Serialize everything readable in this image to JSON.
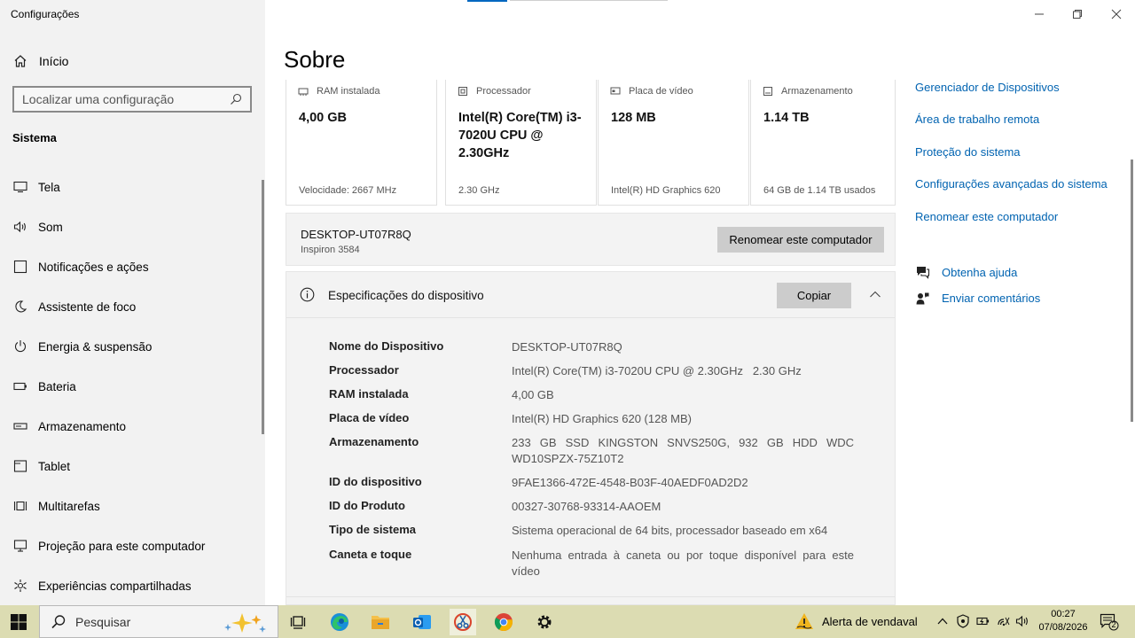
{
  "window": {
    "title": "Configurações"
  },
  "sidebar": {
    "home_label": "Início",
    "search_placeholder": "Localizar uma configuração",
    "section_title": "Sistema",
    "items": [
      {
        "label": "Tela",
        "icon": "monitor-icon"
      },
      {
        "label": "Som",
        "icon": "speaker-icon"
      },
      {
        "label": "Notificações e ações",
        "icon": "notification-icon"
      },
      {
        "label": "Assistente de foco",
        "icon": "moon-icon"
      },
      {
        "label": "Energia & suspensão",
        "icon": "power-icon"
      },
      {
        "label": "Bateria",
        "icon": "battery-icon"
      },
      {
        "label": "Armazenamento",
        "icon": "storage-icon"
      },
      {
        "label": "Tablet",
        "icon": "tablet-icon"
      },
      {
        "label": "Multitarefas",
        "icon": "multitask-icon"
      },
      {
        "label": "Projeção para este computador",
        "icon": "projection-icon"
      },
      {
        "label": "Experiências compartilhadas",
        "icon": "shared-icon"
      }
    ]
  },
  "main": {
    "title": "Sobre",
    "cards": [
      {
        "heading": "RAM instalada",
        "value": "4,00 GB",
        "footer": "Velocidade: 2667 MHz",
        "icon": "ram-icon"
      },
      {
        "heading": "Processador",
        "value": "Intel(R) Core(TM) i3-7020U CPU @ 2.30GHz",
        "footer": "2.30 GHz",
        "icon": "cpu-icon"
      },
      {
        "heading": "Placa de vídeo",
        "value": "128 MB",
        "footer": "Intel(R) HD Graphics 620",
        "icon": "gpu-icon"
      },
      {
        "heading": "Armazenamento",
        "value": "1.14 TB",
        "footer": "64 GB de 1.14 TB usados",
        "icon": "disk-icon"
      }
    ],
    "pc": {
      "name": "DESKTOP-UT07R8Q",
      "model": "Inspiron 3584",
      "rename_label": "Renomear este computador"
    },
    "specs": {
      "title": "Especificações do dispositivo",
      "copy_label": "Copiar",
      "rows": [
        {
          "label": "Nome do Dispositivo",
          "value": "DESKTOP-UT07R8Q"
        },
        {
          "label": "Processador",
          "value": "Intel(R) Core(TM) i3-7020U CPU @ 2.30GHz   2.30 GHz"
        },
        {
          "label": "RAM instalada",
          "value": "4,00 GB"
        },
        {
          "label": "Placa de vídeo",
          "value": "Intel(R) HD Graphics 620 (128 MB)"
        },
        {
          "label": "Armazenamento",
          "value": "233 GB SSD KINGSTON SNVS250G, 932 GB HDD WDC WD10SPZX-75Z10T2"
        },
        {
          "label": "ID do dispositivo",
          "value": "9FAE1366-472E-4548-B03F-40AEDF0AD2D2"
        },
        {
          "label": "ID do Produto",
          "value": "00327-30768-93314-AAOEM"
        },
        {
          "label": "Tipo de sistema",
          "value": "Sistema operacional de 64 bits, processador baseado em x64"
        },
        {
          "label": "Caneta e toque",
          "value": "Nenhuma entrada à caneta ou por toque disponível para este vídeo"
        }
      ]
    }
  },
  "related": {
    "links": [
      "Gerenciador de Dispositivos",
      "Área de trabalho remota",
      "Proteção do sistema",
      "Configurações avançadas do sistema",
      "Renomear este computador"
    ],
    "help": "Obtenha ajuda",
    "feedback": "Enviar comentários"
  },
  "taskbar": {
    "search_placeholder": "Pesquisar",
    "weather_text": "Alerta de vendaval",
    "time": "00:27",
    "date": "07/08/2026",
    "notification_count": "2",
    "accent": "#dcdcb2"
  }
}
